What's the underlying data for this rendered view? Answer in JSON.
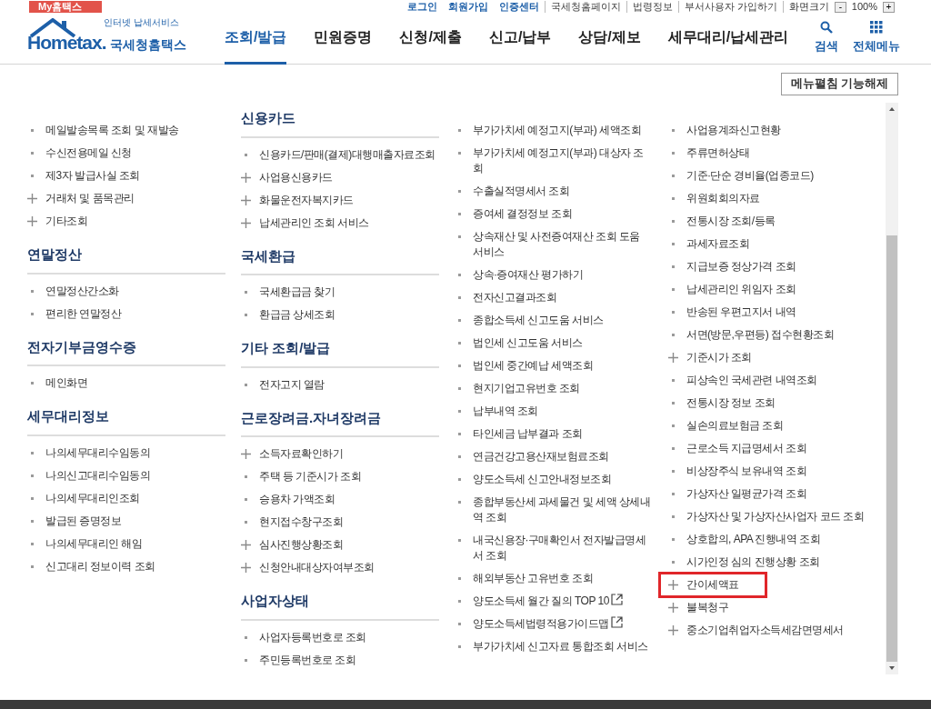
{
  "top_bar": {
    "my_tab": "My홈택스",
    "links": [
      {
        "label": "로그인",
        "kind": "main"
      },
      {
        "label": "회원가입",
        "kind": "main"
      },
      {
        "label": "인증센터",
        "kind": "main"
      },
      {
        "label": "국세청홈페이지",
        "kind": "sub"
      },
      {
        "label": "법령정보",
        "kind": "sub"
      },
      {
        "label": "부서사용자 가입하기",
        "kind": "sub"
      }
    ],
    "zoom_label": "화면크기",
    "zoom_minus": "-",
    "zoom_value": "100%",
    "zoom_plus": "+"
  },
  "header": {
    "logo_tagline": "인터넷 납세서비스",
    "logo_word": "Hometax.",
    "logo_name": "국세청홈택스",
    "nav": [
      {
        "label": "조회/발급",
        "selected": true
      },
      {
        "label": "민원증명",
        "selected": false
      },
      {
        "label": "신청/제출",
        "selected": false
      },
      {
        "label": "신고/납부",
        "selected": false
      },
      {
        "label": "상담/제보",
        "selected": false
      },
      {
        "label": "세무대리/납세관리",
        "selected": false
      }
    ],
    "search": "검색",
    "all_menu": "전체메뉴"
  },
  "menu_toggle_button": "메뉴펼침 기능해제",
  "columns": [
    {
      "sections": [
        {
          "items": [
            {
              "label": "메일발송목록 조회 및 재발송",
              "kind": "dot"
            },
            {
              "label": "수신전용메일 신청",
              "kind": "dot"
            },
            {
              "label": "제3자 발급사실 조회",
              "kind": "dot"
            },
            {
              "label": "거래처 및 품목관리",
              "kind": "plus"
            },
            {
              "label": "기타조회",
              "kind": "plus"
            }
          ]
        },
        {
          "heading": "연말정산",
          "items": [
            {
              "label": "연말정산간소화",
              "kind": "dot"
            },
            {
              "label": "편리한 연말정산",
              "kind": "dot"
            }
          ]
        },
        {
          "heading": "전자기부금영수증",
          "items": [
            {
              "label": "메인화면",
              "kind": "dot"
            }
          ]
        },
        {
          "heading": "세무대리정보",
          "items": [
            {
              "label": "나의세무대리수임동의",
              "kind": "dot"
            },
            {
              "label": "나의신고대리수임동의",
              "kind": "dot"
            },
            {
              "label": "나의세무대리인조회",
              "kind": "dot"
            },
            {
              "label": "발급된 증명정보",
              "kind": "dot"
            },
            {
              "label": "나의세무대리인 해임",
              "kind": "dot"
            },
            {
              "label": "신고대리 정보이력 조회",
              "kind": "dot"
            }
          ]
        }
      ]
    },
    {
      "sections": [
        {
          "heading": "신용카드",
          "items": [
            {
              "label": "신용카드/판매(결제)대행매출자료조회",
              "kind": "dot"
            },
            {
              "label": "사업용신용카드",
              "kind": "plus"
            },
            {
              "label": "화물운전자복지카드",
              "kind": "plus"
            },
            {
              "label": "납세관리인 조회 서비스",
              "kind": "plus"
            }
          ]
        },
        {
          "heading": "국세환급",
          "items": [
            {
              "label": "국세환급금 찾기",
              "kind": "dot"
            },
            {
              "label": "환급금 상세조회",
              "kind": "dot"
            }
          ]
        },
        {
          "heading": "기타 조회/발급",
          "items": [
            {
              "label": "전자고지 열람",
              "kind": "dot"
            }
          ]
        },
        {
          "heading": "근로장려금.자녀장려금",
          "items": [
            {
              "label": "소득자료확인하기",
              "kind": "plus"
            },
            {
              "label": "주택 등 기준시가 조회",
              "kind": "dot"
            },
            {
              "label": "승용차 가액조회",
              "kind": "dot"
            },
            {
              "label": "현지접수창구조회",
              "kind": "dot"
            },
            {
              "label": "심사진행상황조회",
              "kind": "plus"
            },
            {
              "label": "신청안내대상자여부조회",
              "kind": "plus"
            }
          ]
        },
        {
          "heading": "사업자상태",
          "items": [
            {
              "label": "사업자등록번호로 조회",
              "kind": "dot"
            },
            {
              "label": "주민등록번호로 조회",
              "kind": "dot"
            }
          ]
        }
      ]
    },
    {
      "sections": [
        {
          "items": [
            {
              "label": "부가가치세 예정고지(부과) 세액조회",
              "kind": "dot"
            },
            {
              "label": "부가가치세 예정고지(부과) 대상자 조회",
              "kind": "dot"
            },
            {
              "label": "수출실적명세서 조회",
              "kind": "dot"
            },
            {
              "label": "증여세 결정정보 조회",
              "kind": "dot"
            },
            {
              "label": "상속재산 및 사전증여재산 조회 도움 서비스",
              "kind": "dot"
            },
            {
              "label": "상속·증여재산 평가하기",
              "kind": "dot"
            },
            {
              "label": "전자신고결과조회",
              "kind": "dot"
            },
            {
              "label": "종합소득세 신고도움 서비스",
              "kind": "dot"
            },
            {
              "label": "법인세 신고도움 서비스",
              "kind": "dot"
            },
            {
              "label": "법인세 중간예납 세액조회",
              "kind": "dot"
            },
            {
              "label": "현지기업고유번호 조회",
              "kind": "dot"
            },
            {
              "label": "납부내역 조회",
              "kind": "dot"
            },
            {
              "label": "타인세금 납부결과 조회",
              "kind": "dot"
            },
            {
              "label": "연금건강고용산재보험료조회",
              "kind": "dot"
            },
            {
              "label": "양도소득세 신고안내정보조회",
              "kind": "dot"
            },
            {
              "label": "종합부동산세 과세물건 및 세액 상세내역 조회",
              "kind": "dot"
            },
            {
              "label": "내국신용장·구매확인서 전자발급명세서 조회",
              "kind": "dot"
            },
            {
              "label": "해외부동산 고유번호 조회",
              "kind": "dot"
            },
            {
              "label": "양도소득세 월간 질의 TOP 10",
              "kind": "dot",
              "external": true
            },
            {
              "label": "양도소득세법령적용가이드맵",
              "kind": "dot",
              "external": true
            },
            {
              "label": "부가가치세 신고자료 통합조회 서비스",
              "kind": "dot"
            }
          ]
        }
      ]
    },
    {
      "sections": [
        {
          "items": [
            {
              "label": "사업용계좌신고현황",
              "kind": "dot"
            },
            {
              "label": "주류면허상태",
              "kind": "dot"
            },
            {
              "label": "기준·단순 경비율(업종코드)",
              "kind": "dot"
            },
            {
              "label": "위원회회의자료",
              "kind": "dot"
            },
            {
              "label": "전통시장 조회/등록",
              "kind": "dot"
            },
            {
              "label": "과세자료조회",
              "kind": "dot"
            },
            {
              "label": "지급보증 정상가격 조회",
              "kind": "dot"
            },
            {
              "label": "납세관리인 위임자 조회",
              "kind": "dot"
            },
            {
              "label": "반송된 우편고지서 내역",
              "kind": "dot"
            },
            {
              "label": "서면(방문,우편등) 접수현황조회",
              "kind": "dot"
            },
            {
              "label": "기준시가 조회",
              "kind": "plus"
            },
            {
              "label": "피상속인 국세관련 내역조회",
              "kind": "dot"
            },
            {
              "label": "전통시장 정보 조회",
              "kind": "dot"
            },
            {
              "label": "실손의료보험금 조회",
              "kind": "dot"
            },
            {
              "label": "근로소득 지급명세서 조회",
              "kind": "dot"
            },
            {
              "label": "비상장주식 보유내역 조회",
              "kind": "dot"
            },
            {
              "label": "가상자산 일평균가격 조회",
              "kind": "dot"
            },
            {
              "label": "가상자산 및 가상자산사업자 코드 조회",
              "kind": "dot"
            },
            {
              "label": "상호합의, APA 진행내역 조회",
              "kind": "dot"
            },
            {
              "label": "시가인정 심의 진행상황 조회",
              "kind": "dot"
            },
            {
              "label": "간이세액표",
              "kind": "plus",
              "highlighted": true
            },
            {
              "label": "불복청구",
              "kind": "plus"
            },
            {
              "label": "중소기업취업자소득세감면명세서",
              "kind": "plus"
            }
          ]
        }
      ]
    }
  ]
}
